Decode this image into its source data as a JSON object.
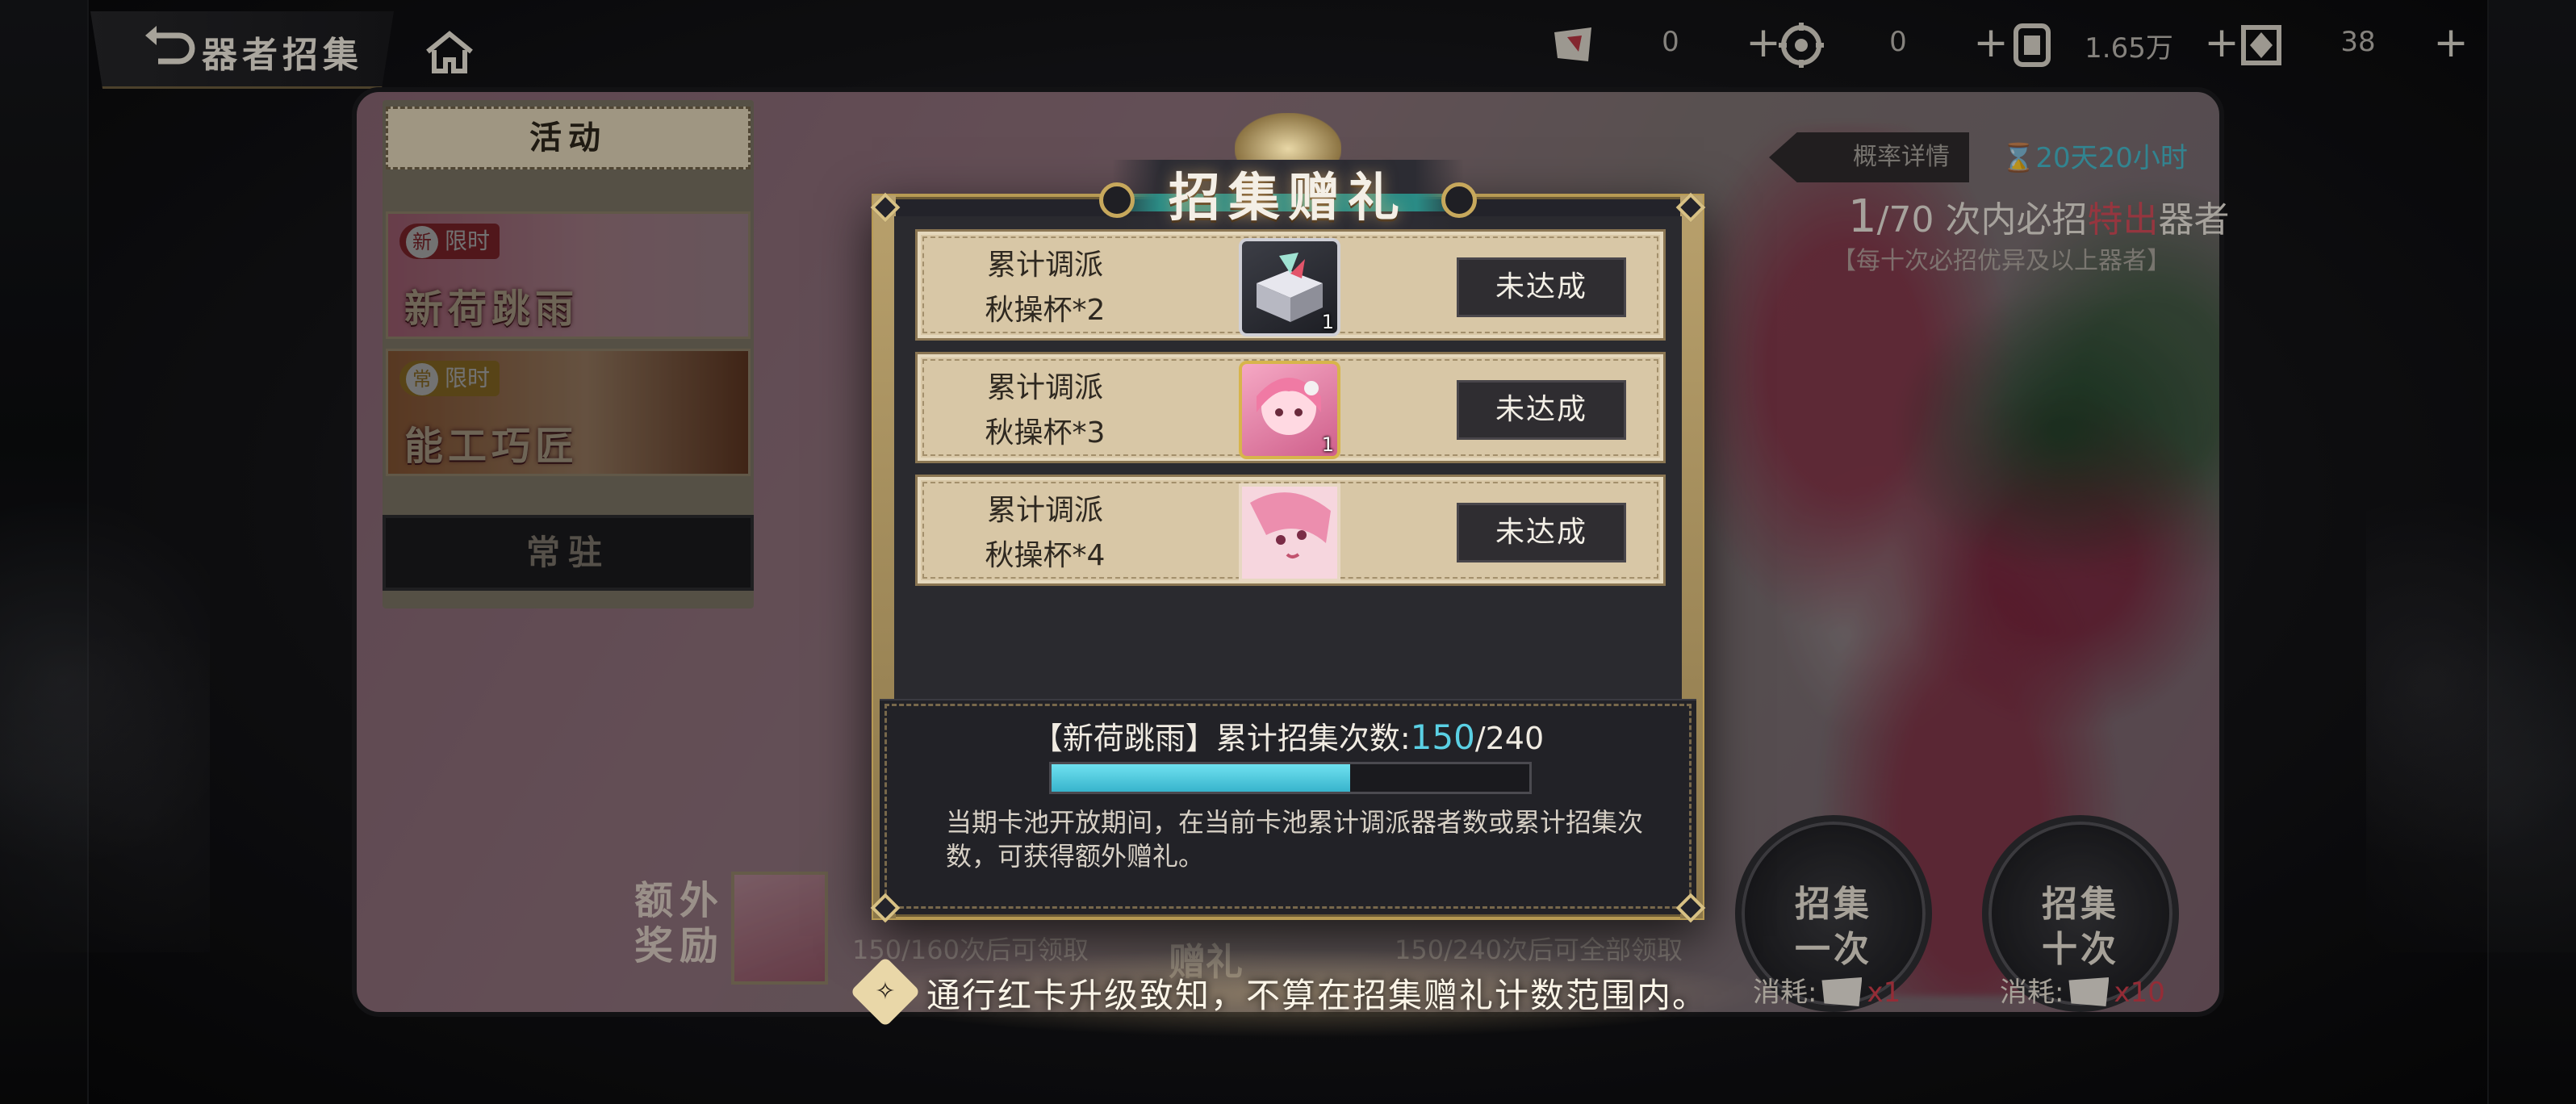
{
  "header": {
    "title": "器者招集",
    "back_icon": "back-arrow-icon",
    "home_icon": "home-icon"
  },
  "resources": [
    {
      "icon": "summon-ticket-icon",
      "value": "0"
    },
    {
      "icon": "gear-currency-icon",
      "value": "0"
    },
    {
      "icon": "coin-stack-icon",
      "value": "1.65万"
    },
    {
      "icon": "crystal-icon",
      "value": "38"
    }
  ],
  "resource_plus": "+",
  "tabs": {
    "event_header": "活动",
    "banners": [
      {
        "tag_mark": "新",
        "tag": "限时",
        "name": "新荷跳雨"
      },
      {
        "tag_mark": "常",
        "tag": "限时",
        "name": "能工巧匠"
      }
    ],
    "regular": "常驻"
  },
  "pool_info": {
    "rate_details": "概率详情",
    "timer": "20天20小时",
    "pity_current": "1",
    "pity_total": "/70",
    "pity_text_a": "次内必招",
    "pity_text_b": "特出",
    "pity_text_c": "器者",
    "pity_note": "【每十次必招优异及以上器者】"
  },
  "bottom_behind": {
    "extra_label_line1": "额外",
    "extra_label_line2": "奖励",
    "extra_count_1": "150/160次后可领取",
    "gift_label": "赠礼",
    "extra_count_2": "150/240次后可全部领取",
    "pull_once_line1": "招集",
    "pull_once_line2": "一次",
    "pull_once_cost_label": "消耗:",
    "pull_once_cost": "x1",
    "pull_ten_line1": "招集",
    "pull_ten_line2": "十次",
    "pull_ten_cost_label": "消耗:",
    "pull_ten_cost": "x10"
  },
  "modal": {
    "title": "招集赠礼",
    "rewards": [
      {
        "cond_line1": "累计调派",
        "cond_line2": "秋操杯*2",
        "item_icon": "gift-box-icon",
        "qty": "1",
        "status": "未达成"
      },
      {
        "cond_line1": "累计调派",
        "cond_line2": "秋操杯*3",
        "item_icon": "character-portrait-icon",
        "qty": "1",
        "status": "未达成"
      },
      {
        "cond_line1": "累计调派",
        "cond_line2": "秋操杯*4",
        "item_icon": "character-art-icon",
        "qty": "",
        "status": "未达成"
      }
    ],
    "progress": {
      "prefix": "【新荷跳雨】累计招集次数:",
      "current": "150",
      "total": "/240",
      "fraction": 0.625
    },
    "description": "当期卡池开放期间，在当前卡池累计调派器者数或累计招集次数，可获得额外赠礼。"
  },
  "tip": {
    "icon": "notice-icon",
    "text": "通行红卡升级致知，不算在招集赠礼计数范围内。"
  },
  "colors": {
    "accent_cyan": "#5ad0e4",
    "accent_red": "#cf3d4b",
    "gold": "#b79a53"
  }
}
